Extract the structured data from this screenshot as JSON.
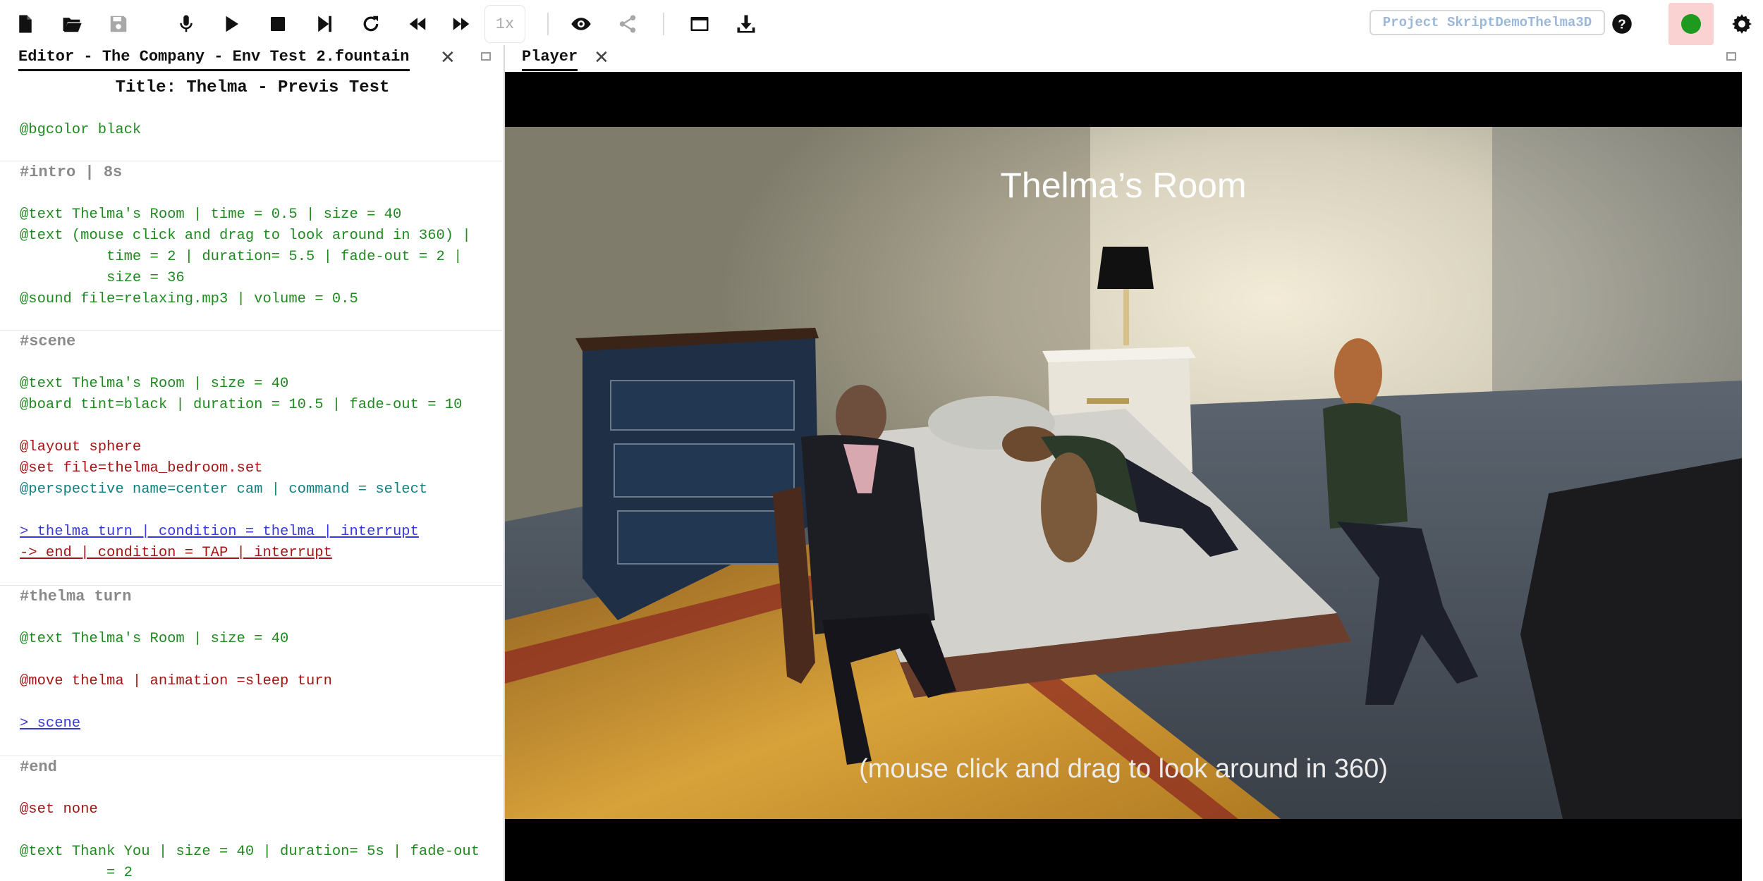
{
  "toolbar": {
    "speed_label": "1x",
    "project_label": "Project SkriptDemoThelma3D",
    "status_color": "#1e9a1e",
    "icons": [
      "new-file-icon",
      "open-folder-icon",
      "save-icon",
      "microphone-icon",
      "play-icon",
      "stop-icon",
      "step-forward-icon",
      "reload-icon",
      "rewind-icon",
      "fast-forward-icon",
      "eye-icon",
      "share-icon",
      "window-icon",
      "download-icon",
      "help-icon",
      "gear-icon"
    ]
  },
  "editor": {
    "tab_label": "Editor - The Company - Env Test 2.fountain",
    "close_glyph": "✕",
    "title_line": "Title: Thelma - Previs Test",
    "lines": {
      "bgcolor": "@bgcolor black",
      "intro_heading": "#intro | 8s",
      "intro_text1": "@text Thelma's Room | time = 0.5 | size = 40",
      "intro_text2a": "@text (mouse click and drag to look around in 360) |",
      "intro_text2b": "          time = 2 | duration= 5.5 | fade-out = 2 |",
      "intro_text2c": "          size = 36",
      "intro_sound": "@sound file=relaxing.mp3 | volume = 0.5",
      "scene_heading": "#scene",
      "scene_text": "@text Thelma's Room | size = 40",
      "scene_board": "@board tint=black | duration = 10.5 | fade-out = 10",
      "scene_layout": "@layout sphere",
      "scene_set": "@set file=thelma_bedroom.set",
      "scene_perspective": "@perspective name=center cam | command = select",
      "scene_link1": "> thelma turn | condition = thelma | interrupt",
      "scene_link2": "-> end | condition = TAP | interrupt",
      "turn_heading": "#thelma turn",
      "turn_text": "@text Thelma's Room | size = 40",
      "turn_move": "@move thelma | animation =sleep turn",
      "turn_link": "> scene",
      "end_heading": "#end",
      "end_set": "@set none",
      "end_text_a": "@text Thank You | size = 40 | duration= 5s | fade-out",
      "end_text_b": "          = 2"
    }
  },
  "player": {
    "tab_label": "Player",
    "close_glyph": "✕",
    "overlay_title": "Thelma’s Room",
    "overlay_subtitle": "(mouse click and drag to look around in 360)"
  }
}
